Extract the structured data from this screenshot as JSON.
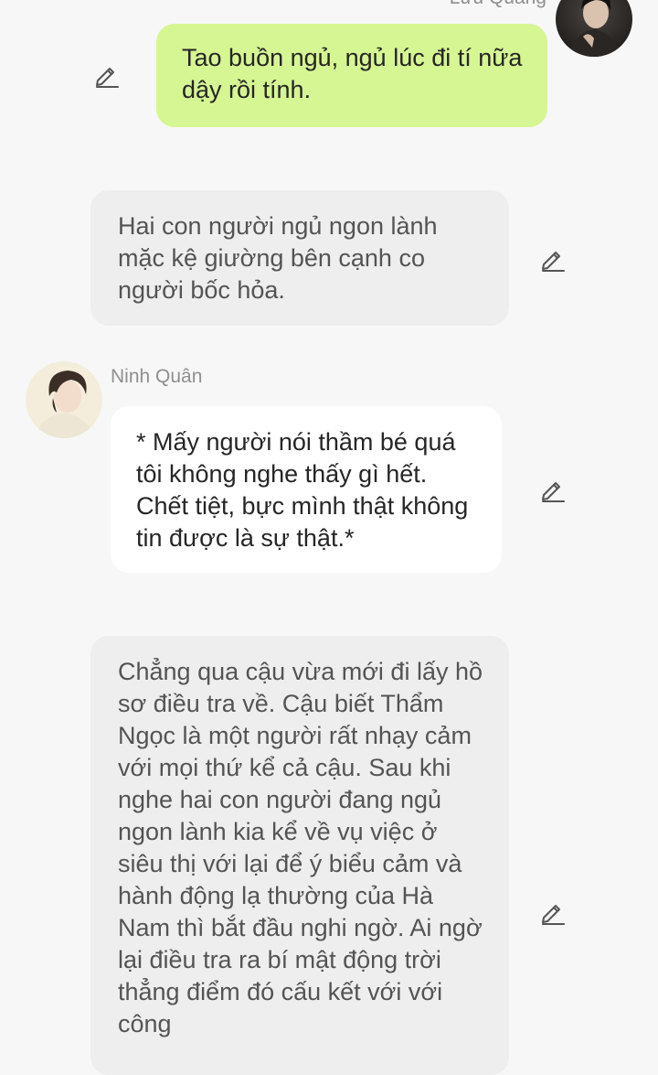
{
  "messages": [
    {
      "sender": "Lưu Quang",
      "text": "Tao buồn ngủ, ngủ lúc đi tí nữa dậy rồi tính."
    },
    {
      "text": "Hai con người ngủ ngon lành mặc kệ giường bên cạnh co người bốc hỏa."
    },
    {
      "sender": "Ninh Quân",
      "text": "* Mấy người nói thầm bé quá tôi không nghe thấy gì hết. Chết tiệt, bực mình thật không tin được là sự thật.*"
    },
    {
      "text": "Chẳng qua cậu vừa mới đi lấy hồ sơ điều tra về. Cậu biết Thẩm Ngọc là một người rất nhạy cảm với mọi thứ kể cả cậu. Sau khi nghe hai con người đang ngủ ngon lành kia kể về vụ việc ở siêu thị với lại để ý biểu cảm và hành động lạ thường của Hà Nam thì bắt đầu nghi ngờ. Ai ngờ lại điều tra ra bí mật động trời thẳng điểm đó cấu kết với với công"
    }
  ],
  "icons": {
    "edit": "pencil-edit-icon"
  },
  "colors": {
    "outgoing_bubble": "#d6f693",
    "incoming_bubble": "#ffffff",
    "narration_bubble": "#eeeeee",
    "background": "#f7f7f7"
  }
}
